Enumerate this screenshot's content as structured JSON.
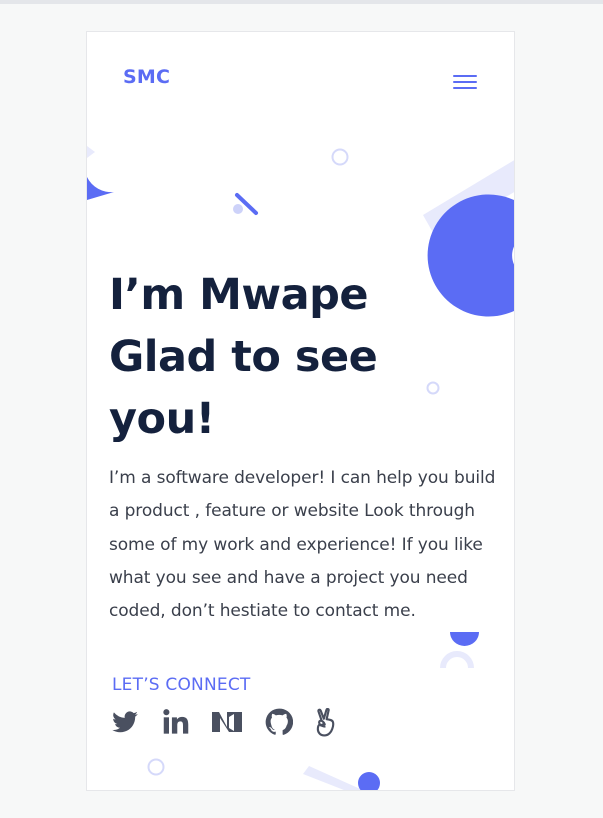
{
  "header": {
    "logo": "SMC",
    "menu_icon": "hamburger-menu-icon"
  },
  "hero": {
    "headline_line1": "I’m Mwape",
    "headline_line2": "Glad to see",
    "headline_line3": "you!",
    "bio": "I’m a software developer! I can help you build a product , feature or website Look through some of my work and experience! If you like what you see and have a project you need coded, don’t hestiate to contact me."
  },
  "connect": {
    "label": "LET’S CONNECT",
    "icons": [
      "twitter-icon",
      "linkedin-icon",
      "medium-icon",
      "github-icon",
      "angellist-icon"
    ]
  },
  "colors": {
    "accent": "#5b6cf4",
    "accent_light": "#e8eafc",
    "headline": "#14213d",
    "body_text": "#3a3f4b",
    "social_icon": "#4a5060"
  }
}
